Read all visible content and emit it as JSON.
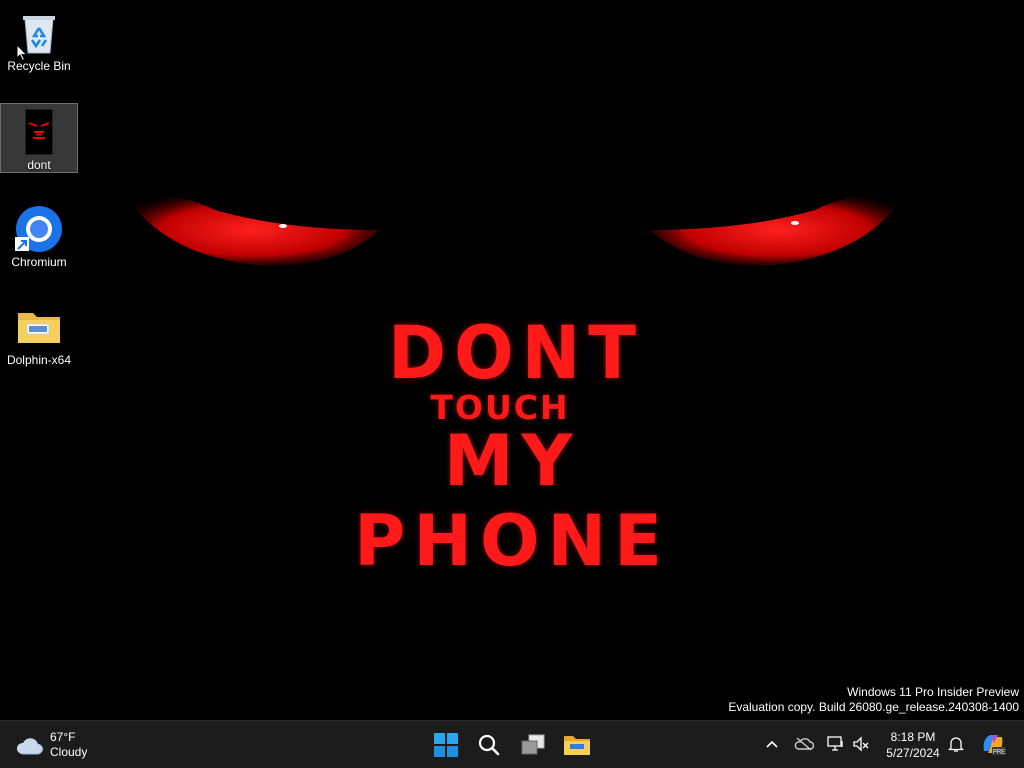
{
  "wallpaper": {
    "line1": "DONT",
    "line2": "TOUCH",
    "line3": "MY",
    "line4": "PHONE",
    "text_color": "#ff1a1a"
  },
  "desktop_icons": [
    {
      "label": "Recycle Bin",
      "icon": "recycle-bin-icon"
    },
    {
      "label": "dont",
      "icon": "image-file-icon"
    },
    {
      "label": "Chromium",
      "icon": "chromium-icon"
    },
    {
      "label": "Dolphin-x64",
      "icon": "folder-icon"
    }
  ],
  "watermark": {
    "line1": "Windows 11 Pro Insider Preview",
    "line2": "Evaluation copy. Build 26080.ge_release.240308-1400"
  },
  "taskbar": {
    "weather": {
      "temp": "67°F",
      "condition": "Cloudy",
      "icon": "cloud-icon"
    },
    "apps": [
      "start-icon",
      "search-icon",
      "task-view-icon",
      "file-explorer-icon"
    ],
    "tray": [
      "chevron-up-icon",
      "onedrive-icon",
      "network-icon",
      "volume-muted-icon",
      "notification-bell-icon",
      "copilot-icon"
    ],
    "clock": {
      "time": "8:18 PM",
      "date": "5/27/2024"
    },
    "copilot_badge": "PRE"
  }
}
